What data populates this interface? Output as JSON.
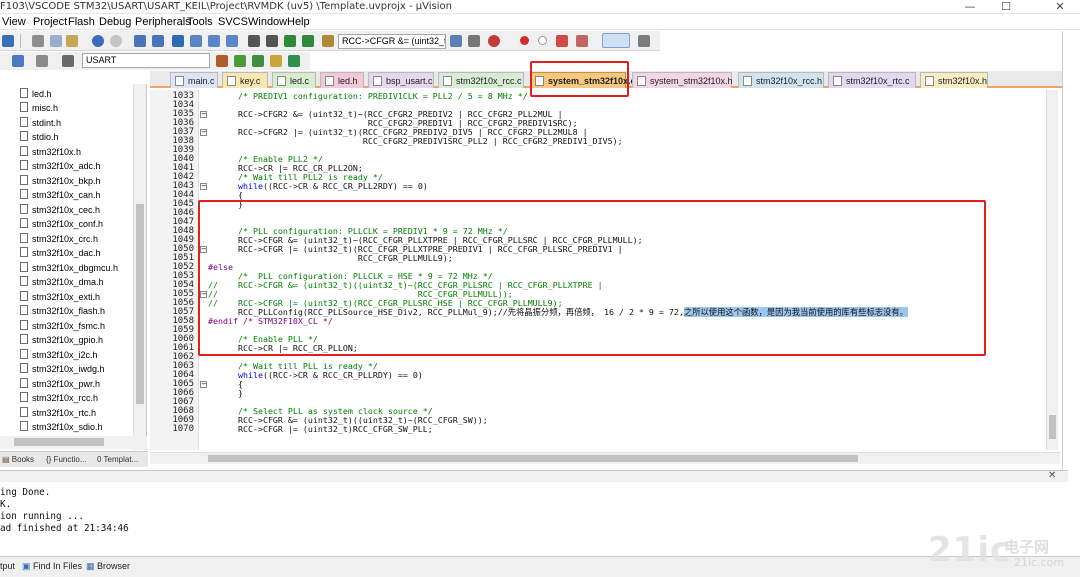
{
  "window": {
    "title": "F103\\VSCODE STM32\\USART\\USART_KEIL\\Project\\RVMDK  (uv5)  \\Template.uvprojx - µVision"
  },
  "menu": [
    "View",
    "Project",
    "Flash",
    "Debug",
    "Peripherals",
    "Tools",
    "SVCS",
    "Window",
    "Help"
  ],
  "toolbar": {
    "find_combo": "RCC->CFGR &= (uint32_t",
    "target_combo": "USART"
  },
  "tabs": [
    "main.c",
    "key.c",
    "led.c",
    "led.h",
    "bsp_usart.c",
    "stm32f10x_rcc.c",
    "system_stm32f10x.c",
    "system_stm32f10x.h",
    "stm32f10x_rcc.h",
    "stm32f10x_rtc.c",
    "stm32f10x.h"
  ],
  "active_tab": "system_stm32f10x.c",
  "sidebar": {
    "files": [
      "led.h",
      "misc.h",
      "stdint.h",
      "stdio.h",
      "stm32f10x.h",
      "stm32f10x_adc.h",
      "stm32f10x_bkp.h",
      "stm32f10x_can.h",
      "stm32f10x_cec.h",
      "stm32f10x_conf.h",
      "stm32f10x_crc.h",
      "stm32f10x_dac.h",
      "stm32f10x_dbgmcu.h",
      "stm32f10x_dma.h",
      "stm32f10x_exti.h",
      "stm32f10x_flash.h",
      "stm32f10x_fsmc.h",
      "stm32f10x_gpio.h",
      "stm32f10x_i2c.h",
      "stm32f10x_iwdg.h",
      "stm32f10x_pwr.h",
      "stm32f10x_rcc.h",
      "stm32f10x_rtc.h",
      "stm32f10x_sdio.h"
    ]
  },
  "bottom_tabs": [
    "Books",
    "Functio...",
    "Templat..."
  ],
  "editor": {
    "lines": [
      {
        "n": "1033",
        "t": "      /* PREDIV1 configuration: PREDIV1CLK = PLL2 / 5 = 8 MHz */",
        "c": "cm"
      },
      {
        "n": "1034",
        "t": "",
        "c": ""
      },
      {
        "n": "1035",
        "t": "      RCC->CFGR2 &= (uint32_t)~(RCC_CFGR2_PREDIV2 | RCC_CFGR2_PLL2MUL |",
        "c": ""
      },
      {
        "n": "1036",
        "t": "                                RCC_CFGR2_PREDIV1 | RCC_CFGR2_PREDIV1SRC);",
        "c": ""
      },
      {
        "n": "1037",
        "t": "      RCC->CFGR2 |= (uint32_t)(RCC_CFGR2_PREDIV2_DIV5 | RCC_CFGR2_PLL2MUL8 |",
        "c": ""
      },
      {
        "n": "1038",
        "t": "                               RCC_CFGR2_PREDIV1SRC_PLL2 | RCC_CFGR2_PREDIV1_DIV5);",
        "c": ""
      },
      {
        "n": "1039",
        "t": "",
        "c": ""
      },
      {
        "n": "1040",
        "t": "      /* Enable PLL2 */",
        "c": "cm"
      },
      {
        "n": "1041",
        "t": "      RCC->CR |= RCC_CR_PLL2ON;",
        "c": ""
      },
      {
        "n": "1042",
        "t": "      /* Wait till PLL2 is ready */",
        "c": "cm"
      },
      {
        "n": "1043",
        "t": "      while((RCC->CR & RCC_CR_PLL2RDY) == 0)",
        "c": "kwl"
      },
      {
        "n": "1044",
        "t": "      {",
        "c": ""
      },
      {
        "n": "1045",
        "t": "      }",
        "c": ""
      },
      {
        "n": "1046",
        "t": "",
        "c": ""
      },
      {
        "n": "1047",
        "t": "",
        "c": ""
      },
      {
        "n": "1048",
        "t": "      /* PLL configuration: PLLCLK = PREDIV1 * 9 = 72 MHz */",
        "c": "cm"
      },
      {
        "n": "1049",
        "t": "      RCC->CFGR &= (uint32_t)~(RCC_CFGR_PLLXTPRE | RCC_CFGR_PLLSRC | RCC_CFGR_PLLMULL);",
        "c": ""
      },
      {
        "n": "1050",
        "t": "      RCC->CFGR |= (uint32_t)(RCC_CFGR_PLLXTPRE_PREDIV1 | RCC_CFGR_PLLSRC_PREDIV1 |",
        "c": ""
      },
      {
        "n": "1051",
        "t": "                              RCC_CFGR_PLLMULL9);",
        "c": ""
      },
      {
        "n": "1052",
        "t": "#else",
        "c": "pp"
      },
      {
        "n": "1053",
        "t": "      /*  PLL configuration: PLLCLK = HSE * 9 = 72 MHz */",
        "c": "cm"
      },
      {
        "n": "1054",
        "t": "//    RCC->CFGR &= (uint32_t)((uint32_t)~(RCC_CFGR_PLLSRC | RCC_CFGR_PLLXTPRE |",
        "c": "cm"
      },
      {
        "n": "1055",
        "t": "//                                        RCC_CFGR_PLLMULL));",
        "c": "cm"
      },
      {
        "n": "1056",
        "t": "//    RCC->CFGR |= (uint32_t)(RCC_CFGR_PLLSRC_HSE | RCC_CFGR_PLLMULL9);",
        "c": "cm"
      },
      {
        "n": "1057",
        "t": "      RCC_PLLConfig(RCC_PLLSource_HSE_Div2, RCC_PLLMul_9);//先将晶振分频，再倍频， 16 / 2 * 9 = 72,",
        "c": "",
        "hl": "之所以使用这个函数，是因为我当前使用的库有些标志没有。"
      },
      {
        "n": "1058",
        "t": "#endif /* STM32F10X_CL */",
        "c": "pp"
      },
      {
        "n": "1059",
        "t": "",
        "c": ""
      },
      {
        "n": "1060",
        "t": "      /* Enable PLL */",
        "c": "cm"
      },
      {
        "n": "1061",
        "t": "      RCC->CR |= RCC_CR_PLLON;",
        "c": ""
      },
      {
        "n": "1062",
        "t": "",
        "c": ""
      },
      {
        "n": "1063",
        "t": "      /* Wait till PLL is ready */",
        "c": "cm"
      },
      {
        "n": "1064",
        "t": "      while((RCC->CR & RCC_CR_PLLRDY) == 0)",
        "c": "kwl"
      },
      {
        "n": "1065",
        "t": "      {",
        "c": ""
      },
      {
        "n": "1066",
        "t": "      }",
        "c": ""
      },
      {
        "n": "1067",
        "t": "",
        "c": ""
      },
      {
        "n": "1068",
        "t": "      /* Select PLL as system clock source */",
        "c": "cm"
      },
      {
        "n": "1069",
        "t": "      RCC->CFGR &= (uint32_t)((uint32_t)~(RCC_CFGR_SW));",
        "c": ""
      },
      {
        "n": "1070",
        "t": "      RCC->CFGR |= (uint32_t)RCC_CFGR_SW_PLL;",
        "c": ""
      }
    ]
  },
  "output": {
    "lines": [
      "ing Done.",
      "K.",
      "ion running ...",
      "ad finished at 21:34:46"
    ]
  },
  "output_tabs": [
    "tput",
    "Find In Files",
    "Browser"
  ],
  "watermark": {
    "text": "21ic",
    "brand": "电子网",
    "domain": "21ic.com"
  }
}
